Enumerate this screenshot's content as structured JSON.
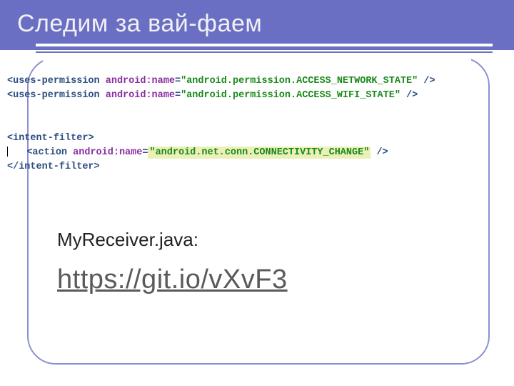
{
  "title": "Следим за вай-фаем",
  "code": {
    "perm1_tag": "uses-permission",
    "perm1_attr": "android:name",
    "perm1_val": "\"android.permission.ACCESS_NETWORK_STATE\"",
    "perm2_tag": "uses-permission",
    "perm2_attr": "android:name",
    "perm2_val": "\"android.permission.ACCESS_WIFI_STATE\"",
    "filter_open": "intent-filter",
    "action_tag": "action",
    "action_attr": "android:name",
    "action_val": "\"android.net.conn.CONNECTIVITY_CHANGE\"",
    "filter_close": "intent-filter"
  },
  "label": "MyReceiver.java:",
  "url": "https://git.io/vXvF3"
}
